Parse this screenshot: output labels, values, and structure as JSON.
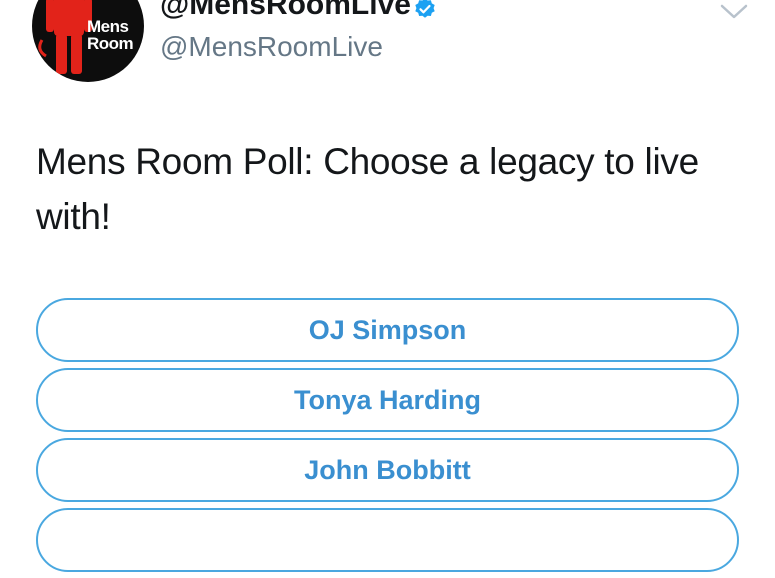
{
  "user": {
    "display_name": "@MensRoomLive",
    "handle": "@MensRoomLive",
    "avatar_text_line1": "Mens",
    "avatar_text_line2": "Room"
  },
  "icons": {
    "verified": "verified-badge-icon",
    "caret": "chevron-down-icon",
    "avatar_figure": "mens-room-figure-icon"
  },
  "tweet": {
    "text": "Mens Room Poll: Choose a legacy to live with!"
  },
  "poll": {
    "options": [
      {
        "label": "OJ Simpson"
      },
      {
        "label": "Tonya Harding"
      },
      {
        "label": "John Bobbitt"
      },
      {
        "label": ""
      }
    ]
  },
  "colors": {
    "accent": "#1da1f2",
    "poll_text": "#3a8fd0",
    "text_primary": "#14171a",
    "text_secondary": "#657786",
    "avatar_bg": "#0d0d0d",
    "avatar_figure": "#e2231a"
  }
}
